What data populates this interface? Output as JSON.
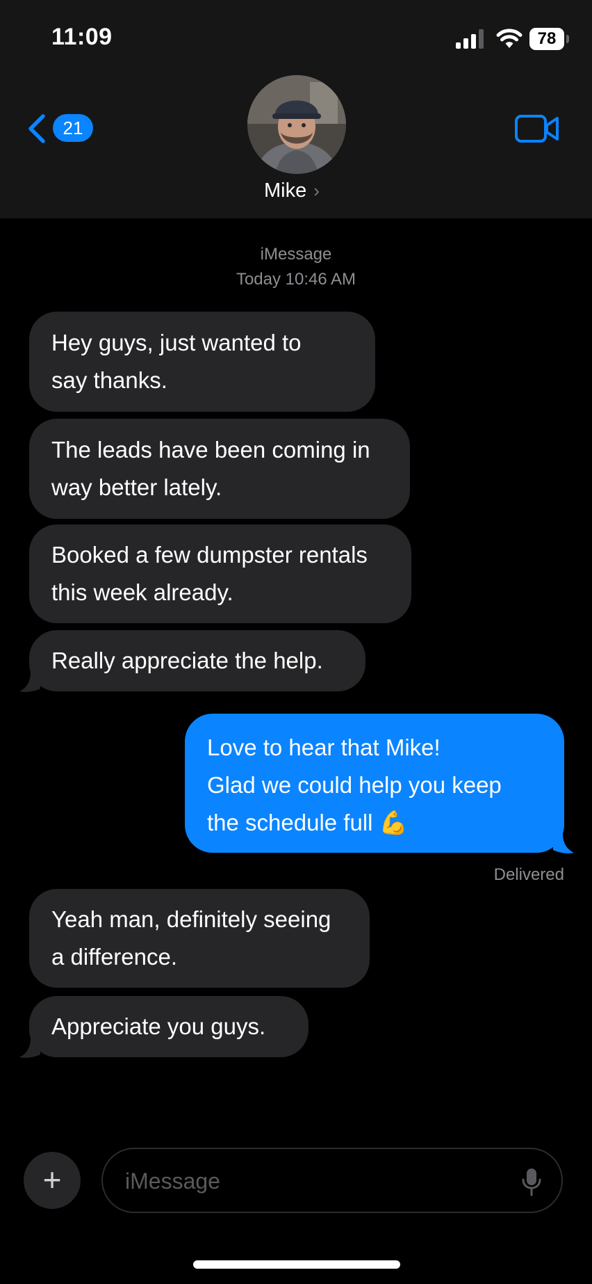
{
  "status_bar": {
    "time": "11:09",
    "battery": "78"
  },
  "nav": {
    "back_count": "21",
    "contact_name": "Mike",
    "contact_chevron": "›"
  },
  "thread": {
    "service": "iMessage",
    "timestamp": "Today 10:46 AM",
    "messages": [
      {
        "direction": "incoming",
        "lines": [
          "Hey guys, just wanted to",
          "say thanks."
        ]
      },
      {
        "direction": "incoming",
        "lines": [
          "The leads have been coming in",
          "way better lately."
        ]
      },
      {
        "direction": "incoming",
        "lines": [
          "Booked a few dumpster rentals",
          "this week already."
        ]
      },
      {
        "direction": "incoming",
        "lines": [
          "Really appreciate the help."
        ]
      },
      {
        "direction": "outgoing",
        "lines": [
          "Love to hear that Mike!",
          "Glad we could help you keep",
          "the schedule full 💪"
        ]
      },
      {
        "direction": "incoming",
        "lines": [
          "Yeah man, definitely seeing",
          "a difference."
        ]
      },
      {
        "direction": "incoming",
        "lines": [
          "Appreciate you guys."
        ]
      }
    ],
    "delivery_status": "Delivered"
  },
  "composer": {
    "plus_label": "+",
    "placeholder": "iMessage"
  },
  "colors": {
    "accent": "#0a84ff",
    "incoming_bubble": "#262628",
    "outgoing_bubble": "#0b84ff",
    "background": "#000000",
    "header": "#161616"
  }
}
